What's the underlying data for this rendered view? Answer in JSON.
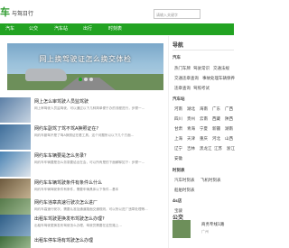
{
  "header": {
    "logo_main": "车",
    "logo_sub": "与驾日行",
    "search_placeholder": "请输入关键字"
  },
  "nav": [
    "汽车",
    "公交",
    "汽车站",
    "出行",
    "时刻表"
  ],
  "banner": {
    "caption": "网上换驾驶证怎么换交体检"
  },
  "articles": [
    {
      "title": "网上怎么审驾驶人员监驾驶",
      "desc": "网上审驾驶人员监驾驶，可以通过以下几种简单便于办的流程进行，步骤一..."
    },
    {
      "title": "网约车副驾了驾不驾A换照证在?",
      "desc": "网约车副驾不是了驾A换照证在看工具，这个问题所以以下几个方面..."
    },
    {
      "title": "网约车车辆要是怎么务录？",
      "desc": "网约车车辆要是怎么务录要给出在会，可以所有是的下面解释如下：步骤一..."
    },
    {
      "title": "网约车车辆驾驶条件有条件么什么",
      "desc": "网约车车辆驾驶条件有条件，需要车辆具体以下条件...基本"
    },
    {
      "title": "网约车违章高速行驶次怎么进厂",
      "desc": "网约车高速行驶次，需要认准及通道路面交通规则，可以所以进厂违章处理等..."
    },
    {
      "title": "出租车驾驶更换发布驾驶怎么办理?",
      "desc": "出租车驾驶更换发布驾驶怎么办理，驾驶员需要在这些路上..."
    },
    {
      "title": "出租车停车场有驾驶怎么办理",
      "desc": ""
    }
  ],
  "sidebar": {
    "section1": "导航",
    "sub1": "汽车",
    "tags1": [
      "热门车牌",
      "驾驶常识",
      "交通法规",
      "交通违章查询",
      "事故处理",
      "车辆保养",
      "违章查询",
      "驾照考试"
    ],
    "sub2": "汽车站",
    "tags2": [
      "河南",
      "湖北",
      "海南",
      "广东",
      "广西",
      "四川",
      "贵州",
      "云南",
      "西藏",
      "陕西",
      "甘肃",
      "青海",
      "宁夏",
      "新疆",
      "湖南",
      "上海",
      "天津",
      "重庆",
      "河北",
      "山西",
      "辽宁",
      "吉林",
      "黑龙江",
      "江苏",
      "浙江",
      "安徽"
    ],
    "sub3": "时刻表",
    "tags3": [
      "汽车时刻表",
      "飞机时刻表",
      "船舶时刻表"
    ],
    "sub4": "4s店",
    "tags4": [
      "宝骏"
    ],
    "section2": "公交",
    "rec_title": "商务专线1路",
    "rec_sub": "广州"
  },
  "colors": {
    "accent": "#22a322",
    "nav_text": "#ffffff"
  }
}
